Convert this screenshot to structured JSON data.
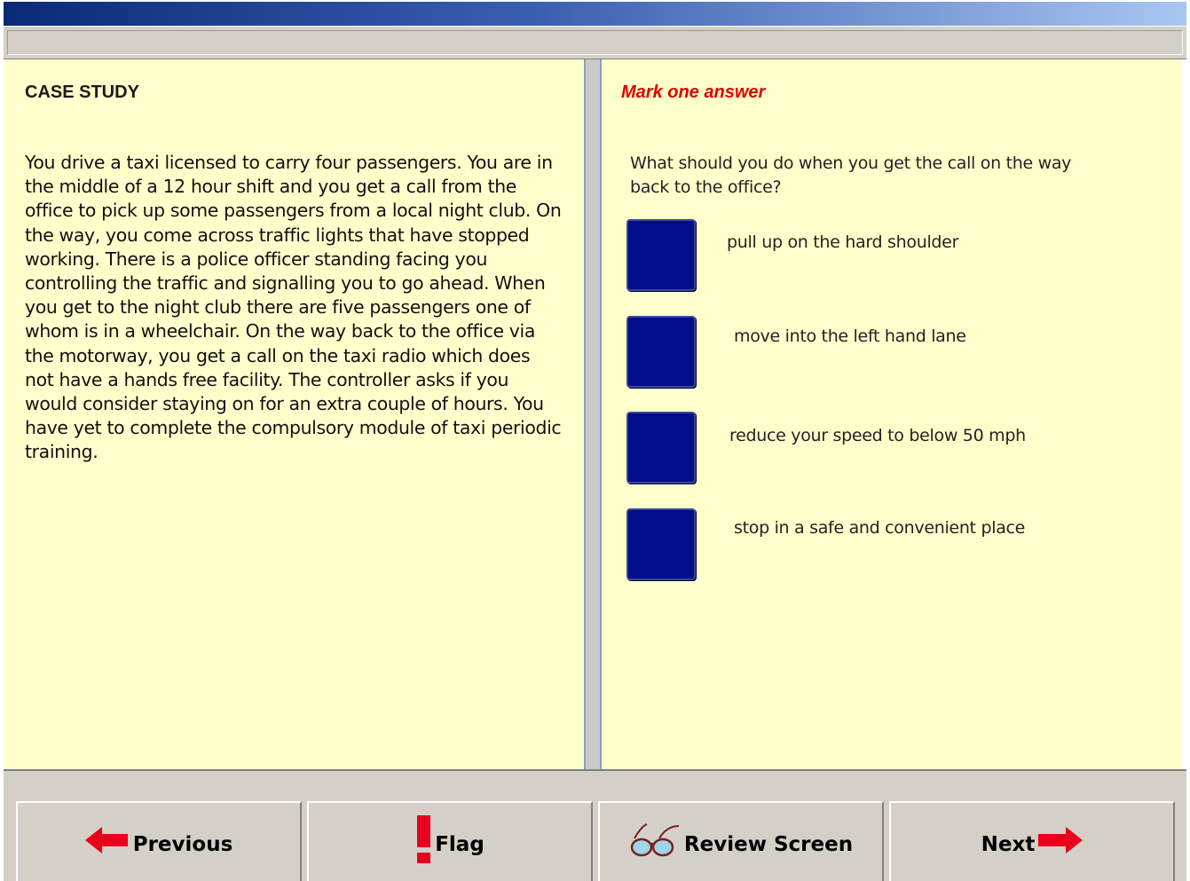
{
  "left": {
    "heading": "CASE STUDY",
    "body": "You drive a taxi licensed to carry four passengers.  You are in the middle of a 12 hour shift and you get a call from the office to pick up some passengers from a local night club.  On the way, you come across traffic lights that have stopped working. There is a police officer standing facing you controlling the traffic and signalling you to go ahead.  When you get to the night club there are five passengers one of whom is in a wheelchair.  On the way back to the office via the motorway, you get a call on the taxi radio which does not have a hands free facility.  The controller asks if you would consider staying on for an extra couple of hours. You have yet to complete the compulsory module of taxi periodic training."
  },
  "right": {
    "instruction": "Mark one answer",
    "question": "What should you do when you get the call on the way back to the office?",
    "options": [
      {
        "label": "pull up on the hard shoulder"
      },
      {
        "label": "move into the left hand lane"
      },
      {
        "label": "reduce your speed to below 50 mph"
      },
      {
        "label": "stop in a safe and convenient place"
      }
    ]
  },
  "footer": {
    "previous": "Previous",
    "flag": "Flag",
    "review": "Review Screen",
    "next": "Next"
  },
  "colors": {
    "panel_bg": "#ffffcc",
    "option_box": "#000c88",
    "instruction": "#e00000",
    "arrow": "#e8001c"
  },
  "icons": {
    "previous": "red-left-arrow-icon",
    "flag": "red-exclamation-icon",
    "review": "glasses-icon",
    "next": "red-right-arrow-icon"
  }
}
